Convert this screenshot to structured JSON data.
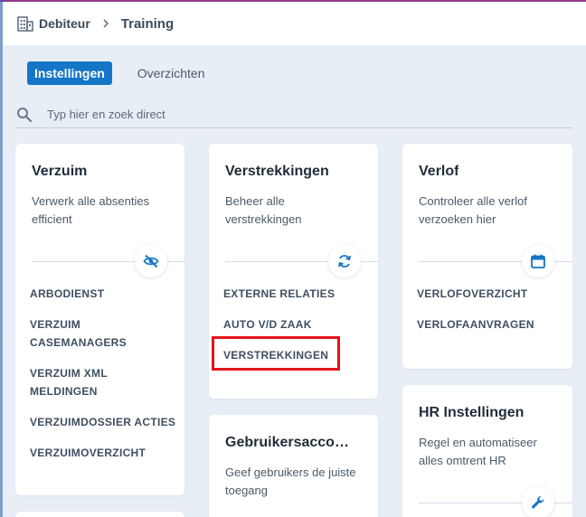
{
  "breadcrumb": {
    "icon": "building-icon",
    "parent": "Debiteur",
    "separator_icon": "chevron-right-icon",
    "current": "Training"
  },
  "tabs": [
    {
      "label": "Instellingen",
      "active": true
    },
    {
      "label": "Overzichten",
      "active": false
    }
  ],
  "search": {
    "icon": "search-icon",
    "placeholder": "Typ hier en zoek direct"
  },
  "colors": {
    "accent": "#1576c8",
    "background": "#e8eef6",
    "highlight": "#e3141c"
  },
  "cards": {
    "verzuim": {
      "title": "Verzuim",
      "description": "Verwerk alle absenties efficient",
      "icon": "eye-off-icon",
      "links": [
        "ARBODIENST",
        "VERZUIM CASEMANAGERS",
        "VERZUIM XML MELDINGEN",
        "VERZUIMDOSSIER ACTIES",
        "VERZUIMOVERZICHT"
      ]
    },
    "verstrekkingen": {
      "title": "Verstrekkingen",
      "description": "Beheer alle verstrekkingen",
      "icon": "sync-icon",
      "links": [
        "EXTERNE RELATIES",
        "AUTO V/D ZAAK",
        "VERSTREKKINGEN"
      ]
    },
    "verlof": {
      "title": "Verlof",
      "description": "Controleer alle verlof verzoeken hier",
      "icon": "calendar-icon",
      "links": [
        "VERLOFOVERZICHT",
        "VERLOFAANVRAGEN"
      ]
    },
    "gebruikers": {
      "title": "Gebruikersacco…",
      "description": "Geef gebruikers de juiste toegang"
    },
    "hr": {
      "title": "HR Instellingen",
      "description": "Regel en automatiseer alles omtrent HR",
      "icon": "wrench-icon"
    }
  }
}
